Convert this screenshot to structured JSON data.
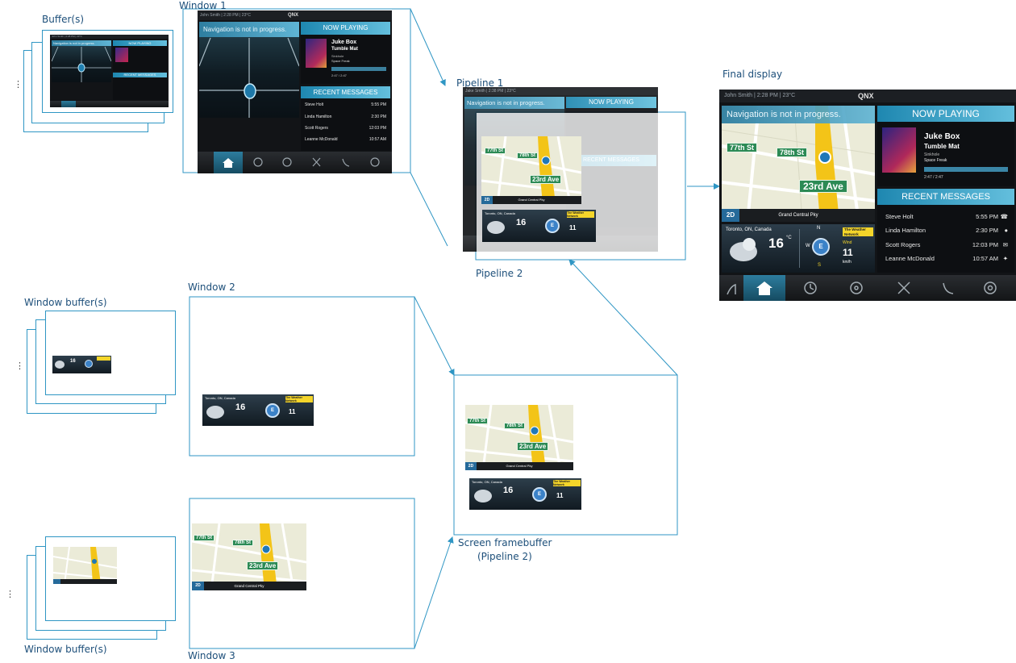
{
  "labels": {
    "buffers": "Buffer(s)",
    "window1": "Window 1",
    "pipeline1": "Pipeline 1",
    "final_display": "Final display",
    "pipeline2": "Pipeline 2",
    "window2": "Window 2",
    "window_buffers_top": "Window buffer(s)",
    "window_buffers_bottom": "Window buffer(s)",
    "window3": "Window 3",
    "screen_framebuffer": "Screen framebuffer",
    "screen_framebuffer_sub": "(Pipeline 2)",
    "ellipsis": "⋮"
  },
  "screen": {
    "user": "John Smith",
    "user_alt": "Jake Smith",
    "clock": "2:28 PM",
    "temp": "23°C",
    "status_line": "John Smith | 2:28 PM | 23°C",
    "status_line_alt": "Jake Smith | 2:38 PM | 23°C",
    "brand": "QNX",
    "nav_message": "Navigation is not in progress.",
    "now_playing_title": "NOW PLAYING",
    "track": "Juke Box",
    "artist": "Tumble Mat",
    "album_line1": "Sinkhole",
    "album_line2": "Space Freak",
    "progress_label": "2:47 / 2:47",
    "progress_fraction": 1.0,
    "messages_title": "RECENT MESSAGES",
    "messages": [
      {
        "name": "Steve Holt",
        "time": "5:55 PM",
        "icon": "phone-icon"
      },
      {
        "name": "Linda Hamilton",
        "time": "2:30 PM",
        "icon": "chat-icon"
      },
      {
        "name": "Scott Rogers",
        "time": "12:03 PM",
        "icon": "mail-icon"
      },
      {
        "name": "Leanne McDonald",
        "time": "10:57 AM",
        "icon": "bird-icon"
      }
    ],
    "dock_icons": [
      "seat-icon",
      "home-icon",
      "clock-icon",
      "music-icon",
      "tools-icon",
      "phone-icon",
      "settings-icon"
    ]
  },
  "map": {
    "streets": [
      "77th St",
      "78th St",
      "23rd Ave"
    ],
    "mode_button": "2D",
    "road_name": "Grand Central Pky"
  },
  "weather": {
    "location": "Toronto, ON, Canada",
    "temperature": "16",
    "unit": "°C",
    "compass_n": "N",
    "compass_w": "W",
    "compass_s": "S",
    "compass_center": "E",
    "wind_label": "Wind",
    "wind_value": "11",
    "wind_unit": "km/h",
    "network_logo": "The Weather Network"
  },
  "colors": {
    "label_text": "#1d4f7a",
    "frame_border": "#2f96c4",
    "accent_blue": "#1e87b0",
    "street_green": "#2c8a55",
    "weather_yellow": "#f4d52a"
  }
}
